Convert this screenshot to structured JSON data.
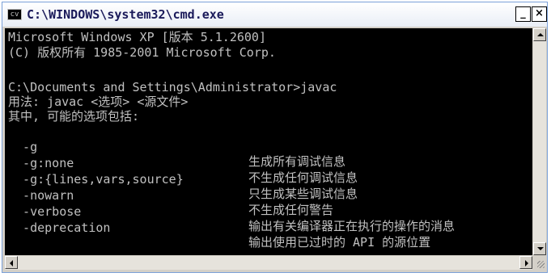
{
  "window": {
    "title": "C:\\WINDOWS\\system32\\cmd.exe",
    "icon_label": "cv",
    "minimize_glyph": "_",
    "close_glyph": "×"
  },
  "console": {
    "lines": [
      "Microsoft Windows XP [版本 5.1.2600]",
      "(C) 版权所有 1985-2001 Microsoft Corp.",
      "",
      "C:\\Documents and Settings\\Administrator>javac",
      "用法: javac <选项> <源文件>",
      "其中, 可能的选项包括:"
    ],
    "options": [
      {
        "name": "  -g",
        "desc": "生成所有调试信息"
      },
      {
        "name": "  -g:none",
        "desc": "不生成任何调试信息"
      },
      {
        "name": "  -g:{lines,vars,source}",
        "desc": "只生成某些调试信息"
      },
      {
        "name": "  -nowarn",
        "desc": "不生成任何警告"
      },
      {
        "name": "  -verbose",
        "desc": "输出有关编译器正在执行的操作的消息"
      },
      {
        "name": "  -deprecation",
        "desc": "输出使用已过时的 API 的源位置"
      }
    ]
  },
  "colors": {
    "console_bg": "#000000",
    "console_text": "#c0c0c0",
    "title_text": "#1a1a5a"
  }
}
